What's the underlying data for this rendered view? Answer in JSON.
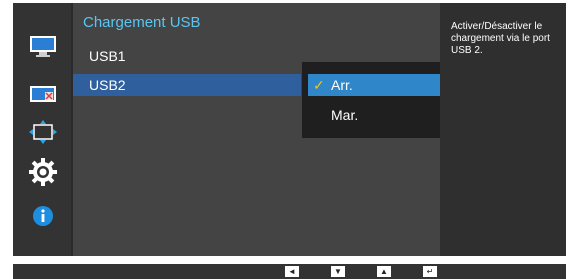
{
  "menu": {
    "title": "Chargement USB",
    "items": [
      {
        "label": "USB1",
        "selected": false
      },
      {
        "label": "USB2",
        "selected": true
      }
    ]
  },
  "dropdown": {
    "options": [
      {
        "label": "Arr.",
        "checked": true
      },
      {
        "label": "Mar.",
        "checked": false
      }
    ],
    "check_symbol": "✓"
  },
  "help": {
    "text": "Activer/Désactiver le chargement via le port USB 2."
  },
  "sidebar": {
    "icons": [
      "monitor-picture-icon",
      "color-screen-icon",
      "size-position-icon",
      "settings-gear-icon",
      "information-icon"
    ]
  },
  "nav_buttons": [
    {
      "name": "left-arrow-icon",
      "glyph": "◄"
    },
    {
      "name": "down-arrow-icon",
      "glyph": "▼"
    },
    {
      "name": "up-arrow-icon",
      "glyph": "▲"
    },
    {
      "name": "enter-icon",
      "glyph": "↵"
    }
  ],
  "colors": {
    "title_accent": "#59c6f1",
    "selected_row": "#2f5f9c",
    "active_option": "#2f86c8",
    "check": "#f3c21a"
  }
}
